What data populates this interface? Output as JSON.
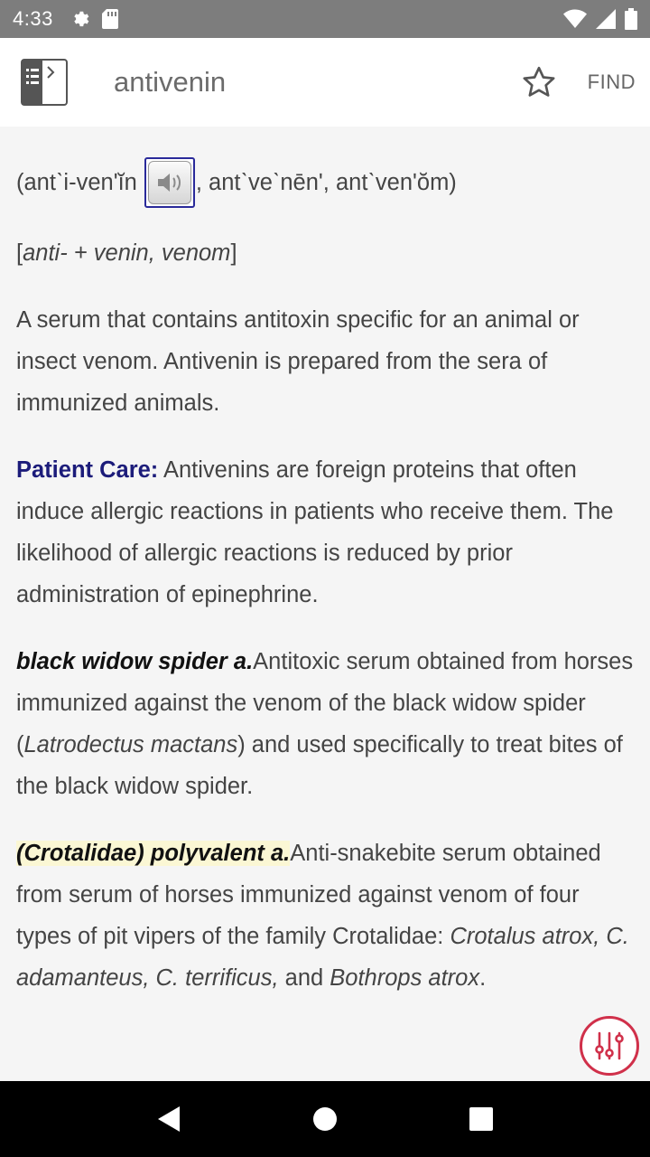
{
  "status_bar": {
    "time": "4:33",
    "icons": [
      "gear-icon",
      "sd-card-icon",
      "wifi-icon",
      "signal-icon",
      "battery-icon"
    ]
  },
  "app_bar": {
    "title": "antivenin",
    "find_label": "FIND",
    "icons": [
      "book-sidebar-icon",
      "star-outline-icon"
    ]
  },
  "entry": {
    "pronunciation_before": "(antˋi-venʹĭn",
    "pronunciation_after": ", antˋveˋnēnʹ, antˋvenʹŏm)",
    "etymology_open": "[",
    "etymology_italic": "anti- + venin, venom",
    "etymology_close": "]",
    "definition": "A serum that contains antitoxin specific for an animal or insect venom. Antivenin is prepared from the sera of immunized animals.",
    "patient_care_label": "Patient Care:",
    "patient_care_text": " Antivenins are foreign proteins that often induce allergic reactions in patients who receive them. The likelihood of allergic reactions is reduced by prior administration of epinephrine.",
    "black_widow": {
      "term": "black widow spider a.",
      "text_1": "Antitoxic serum obtained from horses immunized against the venom of the black widow spider (",
      "species": "Latrodectus mactans",
      "text_2": ") and used specifically to treat bites of the black widow spider."
    },
    "crotalidae": {
      "term": "(Crotalidae) polyvalent a.",
      "text_1": "Anti-snakebite serum obtained from serum of horses immunized against venom of four types of pit vipers of the family Crotalidae: ",
      "species_1": "Crotalus atrox, C. adamanteus, C. terrificus,",
      "text_2": " and ",
      "species_2": "Bothrops atrox",
      "text_3": "."
    }
  },
  "colors": {
    "accent_label": "#1c1c7a",
    "fab_border": "#d0304a",
    "highlight": "#fbf7d4"
  }
}
